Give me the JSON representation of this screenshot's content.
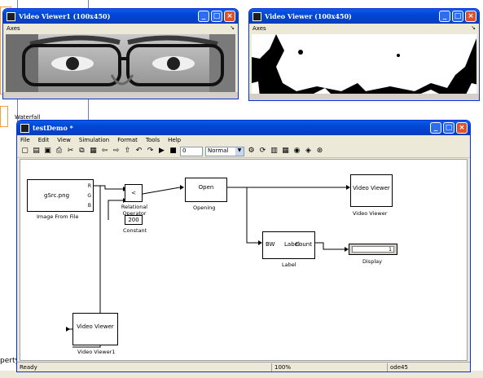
{
  "desktop": {
    "waterfall_label": "Waterfall",
    "perty_fragment": "perty"
  },
  "viewer1": {
    "title": "Video Viewer1 (100x450)",
    "menu": "Axes"
  },
  "viewer": {
    "title": "Video Viewer (100x450)",
    "menu": "Axes"
  },
  "model": {
    "title": "testDemo *",
    "menu": [
      "File",
      "Edit",
      "View",
      "Simulation",
      "Format",
      "Tools",
      "Help"
    ],
    "toolbar": {
      "stop_time": "0",
      "sim_mode": "Normal"
    },
    "blocks": {
      "image_from_file": {
        "text": "gSrc.png",
        "label": "Image From File",
        "ports": [
          "R",
          "G",
          "B"
        ]
      },
      "relational": {
        "text": "<",
        "label": "Relational Operator"
      },
      "constant": {
        "text": "200",
        "label": "Constant"
      },
      "opening": {
        "text": "Open",
        "label": "Opening"
      },
      "video_viewer": {
        "text": "Video Viewer",
        "label": "Video Viewer"
      },
      "label": {
        "in_port": "BW",
        "text": "Label",
        "out_port": "Count",
        "label": "Label"
      },
      "display": {
        "text": "1",
        "label": "Display"
      },
      "video_viewer1": {
        "text": "Video Viewer",
        "label": "Video Viewer1"
      }
    },
    "status": {
      "ready": "Ready",
      "zoom": "100%",
      "solver": "ode45"
    }
  }
}
